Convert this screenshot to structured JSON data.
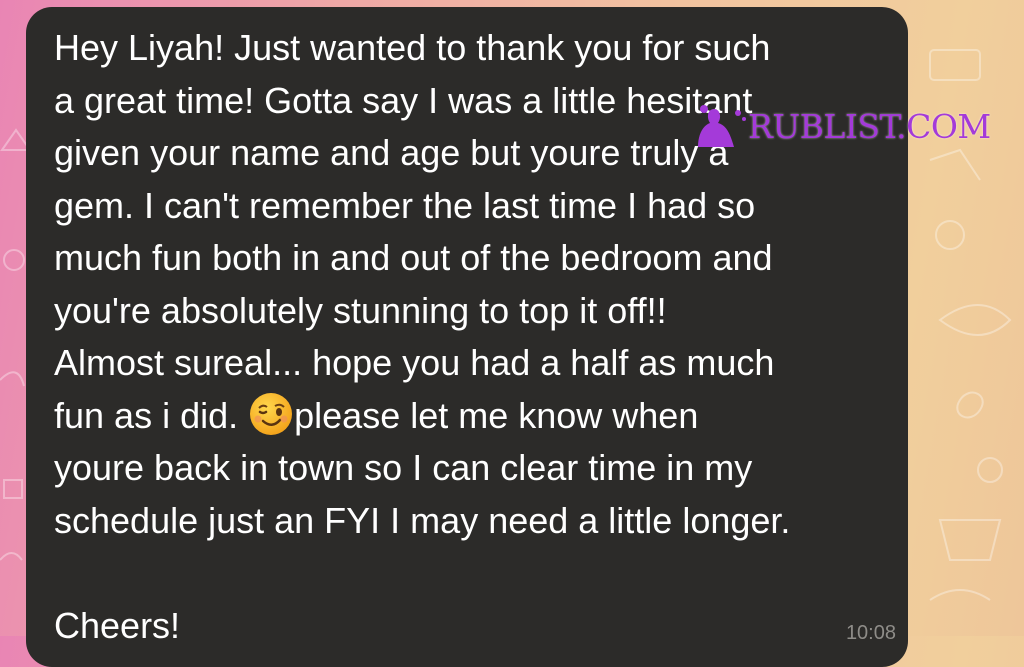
{
  "message": {
    "lines": [
      "Hey Liyah! Just wanted to thank you for such",
      "a great time! Gotta say I was a little hesitant",
      "given your name and age but youre truly a",
      "gem. I can't remember the last time I had so",
      "much fun both in and out of the bedroom and",
      "you're absolutely stunning to top it off!!",
      "Almost sureal... hope you had a half as much",
      "fun as i did. ",
      "please let me know when",
      "youre back in town so I can clear time in my",
      "schedule just an FYI I may need a little longer.",
      "",
      "Cheers!"
    ],
    "emoji": "winking-face-icon",
    "timestamp": "10:08"
  },
  "watermark": {
    "text": "RUBLIST.COM",
    "color": "#a43ad9"
  },
  "colors": {
    "bubble": "#2c2b29",
    "text": "#ffffff"
  }
}
